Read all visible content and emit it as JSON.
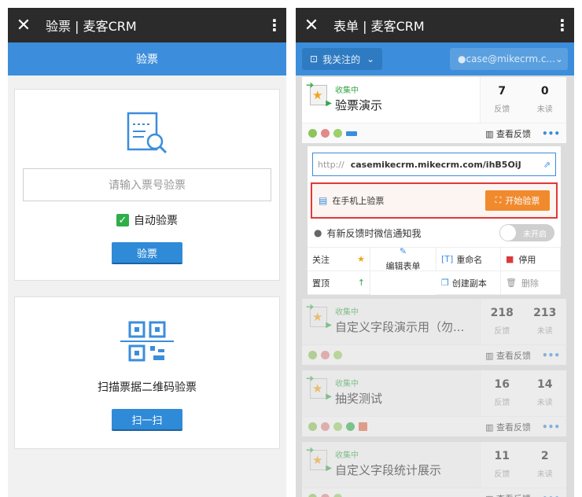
{
  "left": {
    "title": "验票 | 麦客CRM",
    "header": "验票",
    "ticket_placeholder": "请输入票号验票",
    "auto_label": "自动验票",
    "verify_btn": "验票",
    "scan_label": "扫描票据二维码验票",
    "scan_btn": "扫一扫"
  },
  "right": {
    "title": "表单 | 麦客CRM",
    "filter_label": "我关注的",
    "account": "case@mikecrm.c...",
    "view_label": "查看反馈",
    "forms": [
      {
        "status": "收集中",
        "name": "验票演示",
        "feedback": "7",
        "unread": "0"
      },
      {
        "status": "收集中",
        "name": "自定义字段演示用（勿...",
        "feedback": "218",
        "unread": "213"
      },
      {
        "status": "收集中",
        "name": "抽奖测试",
        "feedback": "16",
        "unread": "14"
      },
      {
        "status": "收集中",
        "name": "自定义字段统计展示",
        "feedback": "11",
        "unread": "2"
      }
    ],
    "stat_labels": {
      "feedback": "反馈",
      "unread": "未读"
    },
    "url_prefix": "http://",
    "url": "casemikecrm.mikecrm.com/ihB5OiJ",
    "mobile_verify": "在手机上验票",
    "start_verify": "开始验票",
    "notify": "有新反馈时微信通知我",
    "toggle": "未开启",
    "ops": {
      "follow": "关注",
      "top": "置顶",
      "edit": "编辑表单",
      "rename": "重命名",
      "copy": "创建副本",
      "stop": "停用",
      "delete": "删除"
    }
  }
}
